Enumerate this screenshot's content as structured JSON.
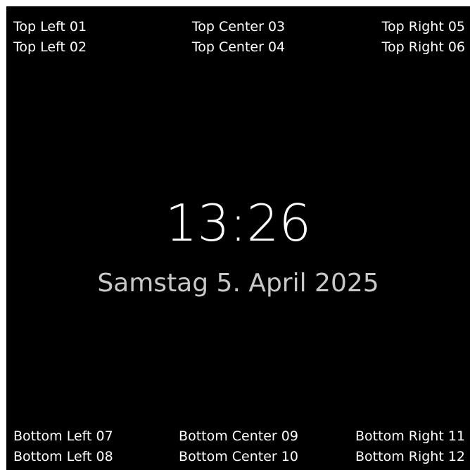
{
  "clock": {
    "time": "13:26",
    "date": "Samstag 5. April 2025"
  },
  "top": {
    "left": [
      "Top Left 01",
      "Top Left 02"
    ],
    "center": [
      "Top Center 03",
      "Top Center 04"
    ],
    "right": [
      "Top Right 05",
      "Top Right 06"
    ]
  },
  "bottom": {
    "left": [
      "Bottom Left 07",
      "Bottom Left 08"
    ],
    "center": [
      "Bottom Center 09",
      "Bottom Center 10"
    ],
    "right": [
      "Bottom Right 11",
      "Bottom Right 12"
    ]
  },
  "colors": {
    "background": "#000000",
    "time_text": "#ffffff",
    "date_text": "#c8c8c8",
    "label_text": "#ffffff"
  }
}
